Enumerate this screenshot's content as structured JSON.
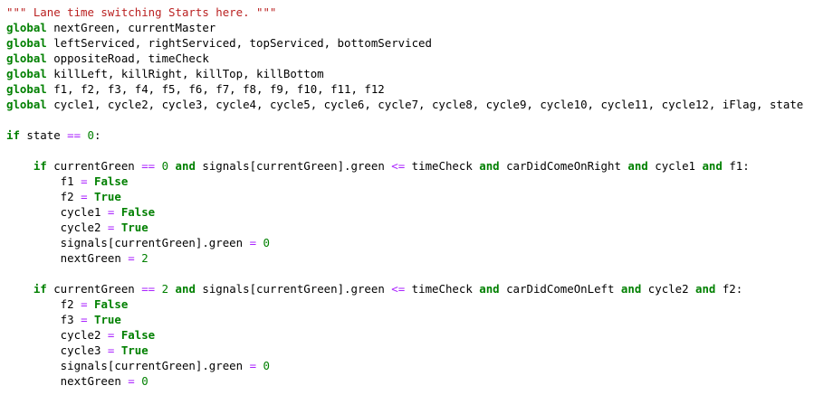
{
  "editor": {
    "lines": [
      [
        {
          "t": "\"\"\" Lane time switching Starts here. \"\"\"",
          "c": "str"
        }
      ],
      [
        {
          "t": "global",
          "c": "kw"
        },
        {
          "t": " nextGreen, currentMaster"
        }
      ],
      [
        {
          "t": "global",
          "c": "kw"
        },
        {
          "t": " leftServiced, rightServiced, topServiced, bottomServiced"
        }
      ],
      [
        {
          "t": "global",
          "c": "kw"
        },
        {
          "t": " oppositeRoad, timeCheck"
        }
      ],
      [
        {
          "t": "global",
          "c": "kw"
        },
        {
          "t": " killLeft, killRight, killTop, killBottom"
        }
      ],
      [
        {
          "t": "global",
          "c": "kw"
        },
        {
          "t": " f1, f2, f3, f4, f5, f6, f7, f8, f9, f10, f11, f12"
        }
      ],
      [
        {
          "t": "global",
          "c": "kw"
        },
        {
          "t": " cycle1, cycle2, cycle3, cycle4, cycle5, cycle6, cycle7, cycle8, cycle9, cycle10, cycle11, cycle12, iFlag, state"
        }
      ],
      [],
      [
        {
          "t": "if",
          "c": "kw"
        },
        {
          "t": " state "
        },
        {
          "t": "==",
          "c": "op"
        },
        {
          "t": " "
        },
        {
          "t": "0",
          "c": "num"
        },
        {
          "t": ":"
        }
      ],
      [],
      [
        {
          "t": "    "
        },
        {
          "t": "if",
          "c": "kw"
        },
        {
          "t": " currentGreen "
        },
        {
          "t": "==",
          "c": "op"
        },
        {
          "t": " "
        },
        {
          "t": "0",
          "c": "num"
        },
        {
          "t": " "
        },
        {
          "t": "and",
          "c": "kw"
        },
        {
          "t": " signals[currentGreen].green "
        },
        {
          "t": "<=",
          "c": "op"
        },
        {
          "t": " timeCheck "
        },
        {
          "t": "and",
          "c": "kw"
        },
        {
          "t": " carDidComeOnRight "
        },
        {
          "t": "and",
          "c": "kw"
        },
        {
          "t": " cycle1 "
        },
        {
          "t": "and",
          "c": "kw"
        },
        {
          "t": " f1:"
        }
      ],
      [
        {
          "t": "        f1 "
        },
        {
          "t": "=",
          "c": "op"
        },
        {
          "t": " "
        },
        {
          "t": "False",
          "c": "const"
        }
      ],
      [
        {
          "t": "        f2 "
        },
        {
          "t": "=",
          "c": "op"
        },
        {
          "t": " "
        },
        {
          "t": "True",
          "c": "const"
        }
      ],
      [
        {
          "t": "        cycle1 "
        },
        {
          "t": "=",
          "c": "op"
        },
        {
          "t": " "
        },
        {
          "t": "False",
          "c": "const"
        }
      ],
      [
        {
          "t": "        cycle2 "
        },
        {
          "t": "=",
          "c": "op"
        },
        {
          "t": " "
        },
        {
          "t": "True",
          "c": "const"
        }
      ],
      [
        {
          "t": "        signals[currentGreen].green "
        },
        {
          "t": "=",
          "c": "op"
        },
        {
          "t": " "
        },
        {
          "t": "0",
          "c": "num"
        }
      ],
      [
        {
          "t": "        nextGreen "
        },
        {
          "t": "=",
          "c": "op"
        },
        {
          "t": " "
        },
        {
          "t": "2",
          "c": "num"
        }
      ],
      [],
      [
        {
          "t": "    "
        },
        {
          "t": "if",
          "c": "kw"
        },
        {
          "t": " currentGreen "
        },
        {
          "t": "==",
          "c": "op"
        },
        {
          "t": " "
        },
        {
          "t": "2",
          "c": "num"
        },
        {
          "t": " "
        },
        {
          "t": "and",
          "c": "kw"
        },
        {
          "t": " signals[currentGreen].green "
        },
        {
          "t": "<=",
          "c": "op"
        },
        {
          "t": " timeCheck "
        },
        {
          "t": "and",
          "c": "kw"
        },
        {
          "t": " carDidComeOnLeft "
        },
        {
          "t": "and",
          "c": "kw"
        },
        {
          "t": " cycle2 "
        },
        {
          "t": "and",
          "c": "kw"
        },
        {
          "t": " f2:"
        }
      ],
      [
        {
          "t": "        f2 "
        },
        {
          "t": "=",
          "c": "op"
        },
        {
          "t": " "
        },
        {
          "t": "False",
          "c": "const"
        }
      ],
      [
        {
          "t": "        f3 "
        },
        {
          "t": "=",
          "c": "op"
        },
        {
          "t": " "
        },
        {
          "t": "True",
          "c": "const"
        }
      ],
      [
        {
          "t": "        cycle2 "
        },
        {
          "t": "=",
          "c": "op"
        },
        {
          "t": " "
        },
        {
          "t": "False",
          "c": "const"
        }
      ],
      [
        {
          "t": "        cycle3 "
        },
        {
          "t": "=",
          "c": "op"
        },
        {
          "t": " "
        },
        {
          "t": "True",
          "c": "const"
        }
      ],
      [
        {
          "t": "        signals[currentGreen].green "
        },
        {
          "t": "=",
          "c": "op"
        },
        {
          "t": " "
        },
        {
          "t": "0",
          "c": "num"
        }
      ],
      [
        {
          "t": "        nextGreen "
        },
        {
          "t": "=",
          "c": "op"
        },
        {
          "t": " "
        },
        {
          "t": "0",
          "c": "num"
        }
      ]
    ]
  },
  "colors": {
    "background": "#ffffff",
    "keyword": "#008000",
    "operator": "#aa22ff",
    "string": "#ba2121",
    "text": "#000000"
  }
}
